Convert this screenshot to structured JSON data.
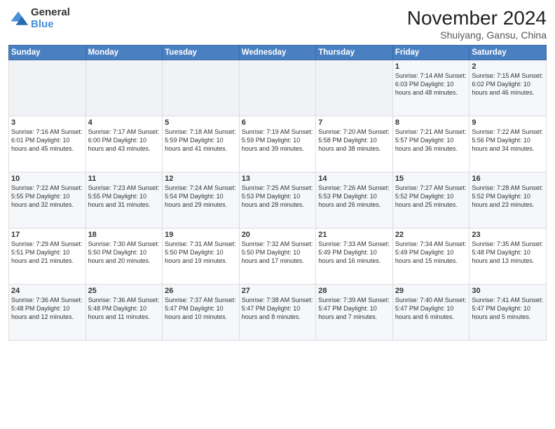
{
  "logo": {
    "general": "General",
    "blue": "Blue"
  },
  "title": "November 2024",
  "location": "Shuiyang, Gansu, China",
  "weekdays": [
    "Sunday",
    "Monday",
    "Tuesday",
    "Wednesday",
    "Thursday",
    "Friday",
    "Saturday"
  ],
  "weeks": [
    [
      {
        "day": "",
        "info": ""
      },
      {
        "day": "",
        "info": ""
      },
      {
        "day": "",
        "info": ""
      },
      {
        "day": "",
        "info": ""
      },
      {
        "day": "",
        "info": ""
      },
      {
        "day": "1",
        "info": "Sunrise: 7:14 AM\nSunset: 6:03 PM\nDaylight: 10 hours\nand 48 minutes."
      },
      {
        "day": "2",
        "info": "Sunrise: 7:15 AM\nSunset: 6:02 PM\nDaylight: 10 hours\nand 46 minutes."
      }
    ],
    [
      {
        "day": "3",
        "info": "Sunrise: 7:16 AM\nSunset: 6:01 PM\nDaylight: 10 hours\nand 45 minutes."
      },
      {
        "day": "4",
        "info": "Sunrise: 7:17 AM\nSunset: 6:00 PM\nDaylight: 10 hours\nand 43 minutes."
      },
      {
        "day": "5",
        "info": "Sunrise: 7:18 AM\nSunset: 5:59 PM\nDaylight: 10 hours\nand 41 minutes."
      },
      {
        "day": "6",
        "info": "Sunrise: 7:19 AM\nSunset: 5:59 PM\nDaylight: 10 hours\nand 39 minutes."
      },
      {
        "day": "7",
        "info": "Sunrise: 7:20 AM\nSunset: 5:58 PM\nDaylight: 10 hours\nand 38 minutes."
      },
      {
        "day": "8",
        "info": "Sunrise: 7:21 AM\nSunset: 5:57 PM\nDaylight: 10 hours\nand 36 minutes."
      },
      {
        "day": "9",
        "info": "Sunrise: 7:22 AM\nSunset: 5:56 PM\nDaylight: 10 hours\nand 34 minutes."
      }
    ],
    [
      {
        "day": "10",
        "info": "Sunrise: 7:22 AM\nSunset: 5:55 PM\nDaylight: 10 hours\nand 32 minutes."
      },
      {
        "day": "11",
        "info": "Sunrise: 7:23 AM\nSunset: 5:55 PM\nDaylight: 10 hours\nand 31 minutes."
      },
      {
        "day": "12",
        "info": "Sunrise: 7:24 AM\nSunset: 5:54 PM\nDaylight: 10 hours\nand 29 minutes."
      },
      {
        "day": "13",
        "info": "Sunrise: 7:25 AM\nSunset: 5:53 PM\nDaylight: 10 hours\nand 28 minutes."
      },
      {
        "day": "14",
        "info": "Sunrise: 7:26 AM\nSunset: 5:53 PM\nDaylight: 10 hours\nand 26 minutes."
      },
      {
        "day": "15",
        "info": "Sunrise: 7:27 AM\nSunset: 5:52 PM\nDaylight: 10 hours\nand 25 minutes."
      },
      {
        "day": "16",
        "info": "Sunrise: 7:28 AM\nSunset: 5:52 PM\nDaylight: 10 hours\nand 23 minutes."
      }
    ],
    [
      {
        "day": "17",
        "info": "Sunrise: 7:29 AM\nSunset: 5:51 PM\nDaylight: 10 hours\nand 21 minutes."
      },
      {
        "day": "18",
        "info": "Sunrise: 7:30 AM\nSunset: 5:50 PM\nDaylight: 10 hours\nand 20 minutes."
      },
      {
        "day": "19",
        "info": "Sunrise: 7:31 AM\nSunset: 5:50 PM\nDaylight: 10 hours\nand 19 minutes."
      },
      {
        "day": "20",
        "info": "Sunrise: 7:32 AM\nSunset: 5:50 PM\nDaylight: 10 hours\nand 17 minutes."
      },
      {
        "day": "21",
        "info": "Sunrise: 7:33 AM\nSunset: 5:49 PM\nDaylight: 10 hours\nand 16 minutes."
      },
      {
        "day": "22",
        "info": "Sunrise: 7:34 AM\nSunset: 5:49 PM\nDaylight: 10 hours\nand 15 minutes."
      },
      {
        "day": "23",
        "info": "Sunrise: 7:35 AM\nSunset: 5:48 PM\nDaylight: 10 hours\nand 13 minutes."
      }
    ],
    [
      {
        "day": "24",
        "info": "Sunrise: 7:36 AM\nSunset: 5:48 PM\nDaylight: 10 hours\nand 12 minutes."
      },
      {
        "day": "25",
        "info": "Sunrise: 7:36 AM\nSunset: 5:48 PM\nDaylight: 10 hours\nand 11 minutes."
      },
      {
        "day": "26",
        "info": "Sunrise: 7:37 AM\nSunset: 5:47 PM\nDaylight: 10 hours\nand 10 minutes."
      },
      {
        "day": "27",
        "info": "Sunrise: 7:38 AM\nSunset: 5:47 PM\nDaylight: 10 hours\nand 8 minutes."
      },
      {
        "day": "28",
        "info": "Sunrise: 7:39 AM\nSunset: 5:47 PM\nDaylight: 10 hours\nand 7 minutes."
      },
      {
        "day": "29",
        "info": "Sunrise: 7:40 AM\nSunset: 5:47 PM\nDaylight: 10 hours\nand 6 minutes."
      },
      {
        "day": "30",
        "info": "Sunrise: 7:41 AM\nSunset: 5:47 PM\nDaylight: 10 hours\nand 5 minutes."
      }
    ]
  ]
}
